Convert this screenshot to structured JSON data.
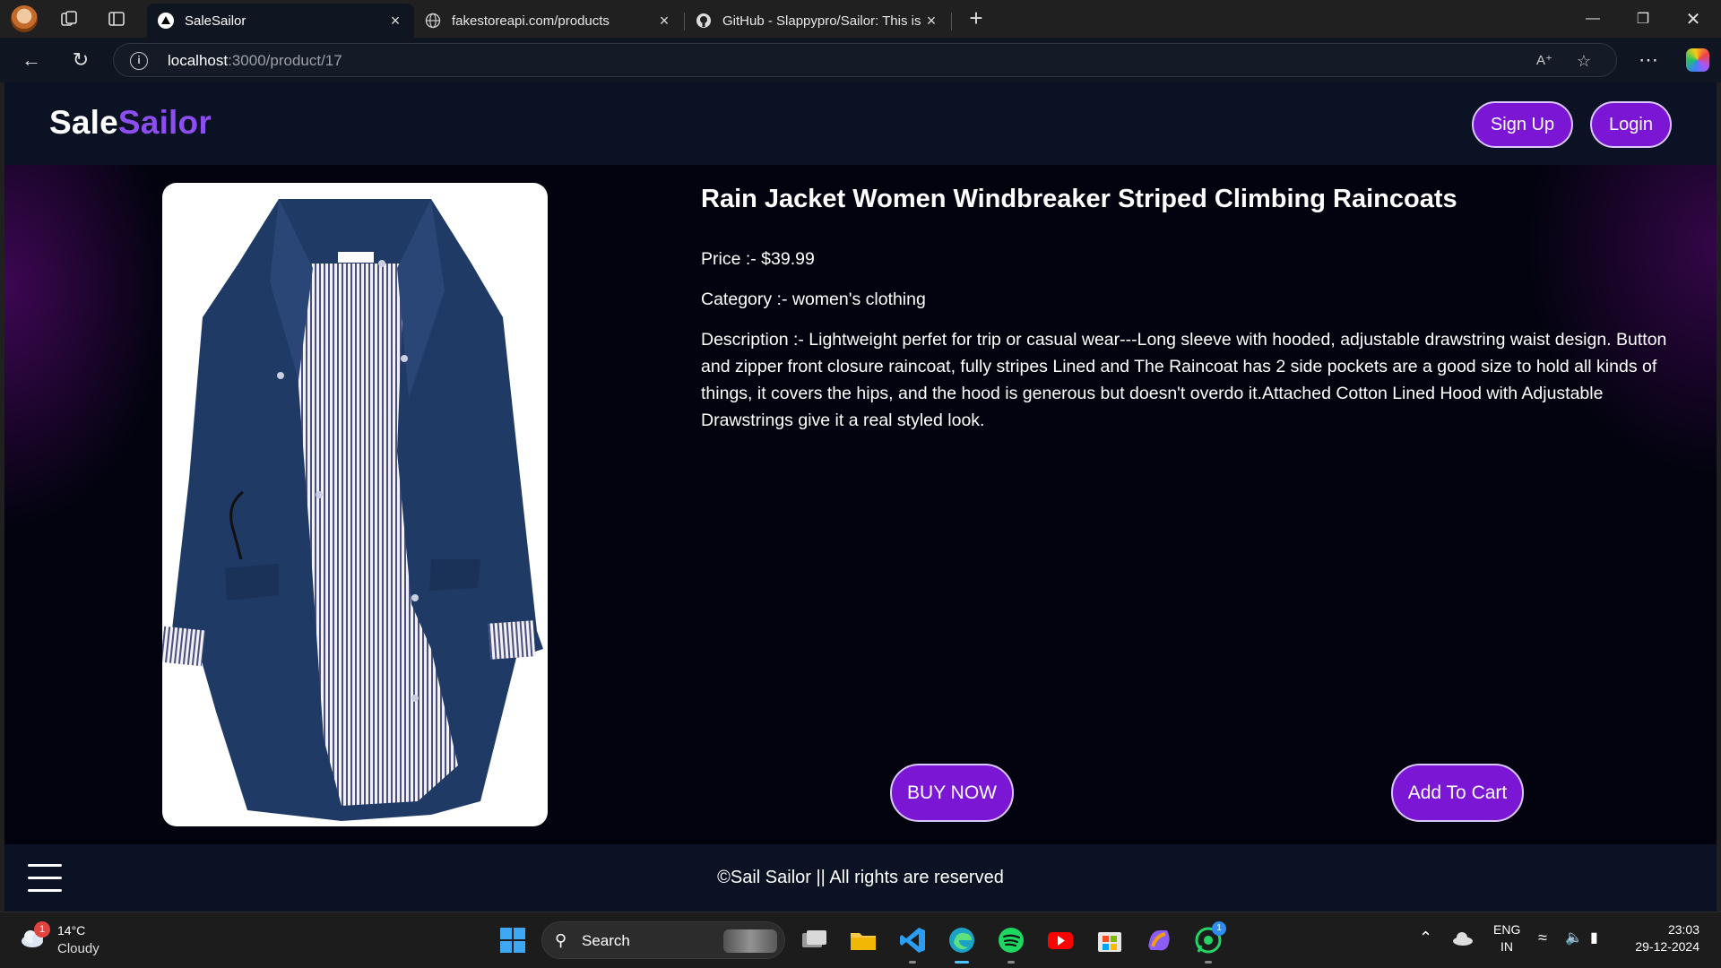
{
  "browser": {
    "tabs": [
      {
        "label": "SaleSailor",
        "favicon": "vercel-triangle-icon",
        "active": true
      },
      {
        "label": "fakestoreapi.com/products",
        "favicon": "globe-icon",
        "active": false
      },
      {
        "label": "GitHub - Slappypro/Sailor: This is",
        "favicon": "github-icon",
        "active": false
      }
    ],
    "url_host": "localhost",
    "url_path": ":3000/product/17"
  },
  "site": {
    "logo_part1": "Sale",
    "logo_part2": "Sailor",
    "signup_label": "Sign Up",
    "login_label": "Login",
    "accent_color": "#7a16d4"
  },
  "product": {
    "title": "Rain Jacket Women Windbreaker Striped Climbing Raincoats",
    "price_line": "Price :- $39.99",
    "category_line": "Category :- women's clothing",
    "description_line": "Description :- Lightweight perfet for trip or casual wear---Long sleeve with hooded, adjustable drawstring waist design. Button and zipper front closure raincoat, fully stripes Lined and The Raincoat has 2 side pockets are a good size to hold all kinds of things, it covers the hips, and the hood is generous but doesn't overdo it.Attached Cotton Lined Hood with Adjustable Drawstrings give it a real styled look.",
    "buy_now_label": "BUY NOW",
    "add_to_cart_label": "Add To Cart",
    "image": "navy-rain-jacket-photo"
  },
  "footer": {
    "copyright": "©Sail Sailor || All rights are reserved"
  },
  "taskbar": {
    "weather_temp": "14°C",
    "weather_cond": "Cloudy",
    "weather_badge": "1",
    "search_label": "Search",
    "lang_1": "ENG",
    "lang_2": "IN",
    "time": "23:03",
    "date": "29-12-2024",
    "whatsapp_badge": "1"
  }
}
